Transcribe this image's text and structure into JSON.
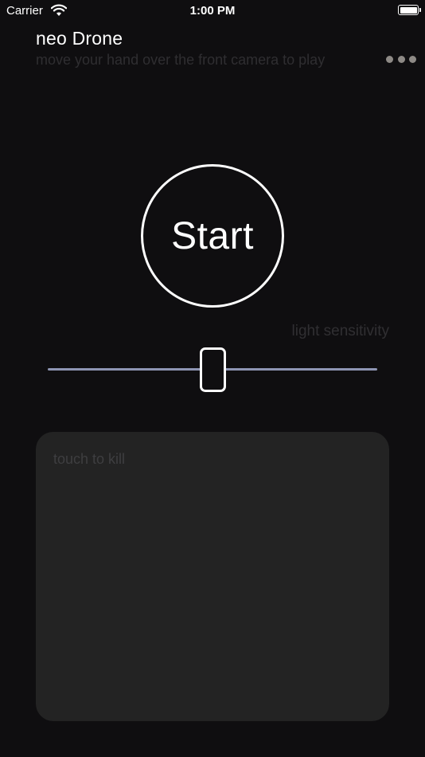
{
  "status_bar": {
    "carrier": "Carrier",
    "time": "1:00 PM"
  },
  "header": {
    "title": "neo Drone",
    "subtitle": "move your hand over the front camera to play",
    "more_icon": "more-horizontal-icon"
  },
  "controls": {
    "start_label": "Start",
    "sensitivity_label": "light sensitivity",
    "sensitivity_value": 0.5
  },
  "kill_pad": {
    "label": "touch to kill"
  },
  "colors": {
    "background": "#0f0e10",
    "panel": "#232323",
    "track": "#8e95b3",
    "dots": "#8e8a86"
  }
}
